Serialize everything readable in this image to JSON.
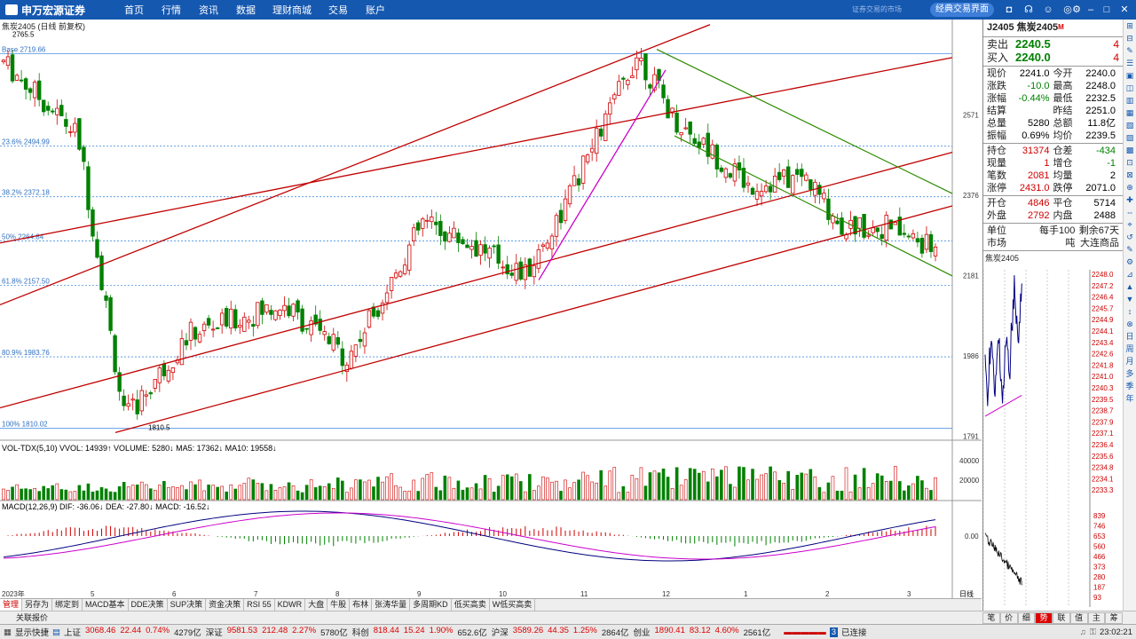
{
  "topbar": {
    "brand": "申万宏源证券",
    "menu": [
      "首页",
      "行情",
      "资讯",
      "数据",
      "理财商城",
      "交易",
      "账户"
    ],
    "slogan": "证券交易的市场",
    "classic": "经典交易界面"
  },
  "chart": {
    "title": "焦炭2405 (日线 前复权)",
    "high_label": "2765.5",
    "low_label": "1810.5",
    "fib": [
      {
        "label": "Base 2719.66",
        "price": 2719.66
      },
      {
        "label": "23.6% 2494.99",
        "price": 2494.99
      },
      {
        "label": "38.2% 2372.18",
        "price": 2372.18
      },
      {
        "label": "50% 2264.84",
        "price": 2264.84
      },
      {
        "label": "61.8% 2157.50",
        "price": 2157.5
      },
      {
        "label": "80.9% 1983.76",
        "price": 1983.76
      },
      {
        "label": "100% 1810.02",
        "price": 1810.02
      }
    ],
    "price_ticks": [
      "2571",
      "2376",
      "2181",
      "1986",
      "1791"
    ],
    "months": [
      "2023年",
      "5",
      "6",
      "7",
      "8",
      "9",
      "10",
      "11",
      "12",
      "1",
      "2",
      "3"
    ],
    "period": "日线",
    "vol_title": "VOL-TDX(5,10) VVOL: 14939↑ VOLUME: 5280↓ MA5: 17362↓ MA10: 19558↓",
    "vol_ticks": [
      "40000",
      "20000"
    ],
    "macd_title": "MACD(12,26,9) DIF: -36.06↓ DEA: -27.80↓ MACD: -16.52↓",
    "macd_tick": "0.00"
  },
  "quote": {
    "code": "J2405",
    "name": "焦炭2405",
    "tag": "M",
    "sell": {
      "label": "卖出",
      "price": "2240.5",
      "qty": "4"
    },
    "buy": {
      "label": "买入",
      "price": "2240.0",
      "qty": "4"
    },
    "rows": [
      [
        "现价",
        "2241.0",
        "今开",
        "2240.0"
      ],
      [
        "涨跌",
        "-10.0",
        "最高",
        "2248.0"
      ],
      [
        "涨幅",
        "-0.44%",
        "最低",
        "2232.5"
      ],
      [
        "结算",
        "",
        "昨结",
        "2251.0"
      ],
      [
        "总量",
        "5280",
        "总额",
        "11.8亿"
      ],
      [
        "振幅",
        "0.69%",
        "均价",
        "2239.5"
      ]
    ],
    "rows2": [
      [
        "持仓",
        "31374",
        "仓差",
        "-434"
      ],
      [
        "现量",
        "1",
        "增仓",
        "-1"
      ],
      [
        "笔数",
        "2081",
        "均量",
        "2"
      ],
      [
        "涨停",
        "2431.0",
        "跌停",
        "2071.0"
      ]
    ],
    "rows3": [
      [
        "开仓",
        "4846",
        "平仓",
        "5714"
      ],
      [
        "外盘",
        "2792",
        "内盘",
        "2488"
      ]
    ],
    "unit": [
      "单位",
      "每手100吨",
      "剩余67天"
    ],
    "market": [
      "市场",
      "大连商品"
    ],
    "mini_title": "焦炭2405",
    "mini_ticks": [
      "2248.0",
      "2247.2",
      "2246.4",
      "2245.7",
      "2244.9",
      "2244.1",
      "2243.4",
      "2242.6",
      "2241.8",
      "2241.0",
      "2240.3",
      "2239.5",
      "2238.7",
      "2237.9",
      "2237.1",
      "2236.4",
      "2235.6",
      "2234.8",
      "2234.1",
      "2233.3"
    ],
    "mini_vol_ticks": [
      "839",
      "746",
      "653",
      "560",
      "466",
      "373",
      "280",
      "187",
      "93"
    ]
  },
  "tabs": [
    "管理",
    "另存为",
    "绑定到",
    "MACD基本",
    "DDE决策",
    "SUP决策",
    "资金决策",
    "RSI 55",
    "KDWR",
    "大盘",
    "牛股",
    "布林",
    "张涛华量",
    "多周期KD",
    "低买高卖",
    "W低买高卖"
  ],
  "bottom_label": "关联报价",
  "right_tabs": [
    "笔",
    "价",
    "细",
    "势",
    "联",
    "值",
    "主",
    "筹"
  ],
  "status": {
    "quick": "显示快捷",
    "sh": [
      "上证",
      "3068.46",
      "22.44",
      "0.74%",
      "4279亿"
    ],
    "sz": [
      "深证",
      "9581.53",
      "212.48",
      "2.27%",
      "5780亿"
    ],
    "kc": [
      "科创",
      "818.44",
      "15.24",
      "1.90%",
      "652.6亿"
    ],
    "hs": [
      "沪深",
      "3589.26",
      "44.35",
      "1.25%",
      "2864亿"
    ],
    "cy": [
      "创业",
      "1890.41",
      "83.12",
      "4.60%",
      "2561亿"
    ],
    "conn": "已连接",
    "time": "23:02:21"
  },
  "colors": {
    "up": "#d00000",
    "down": "#008000",
    "channel_up": "#c00000",
    "channel_down": "#2e8b00",
    "fan": "#cc00cc"
  }
}
